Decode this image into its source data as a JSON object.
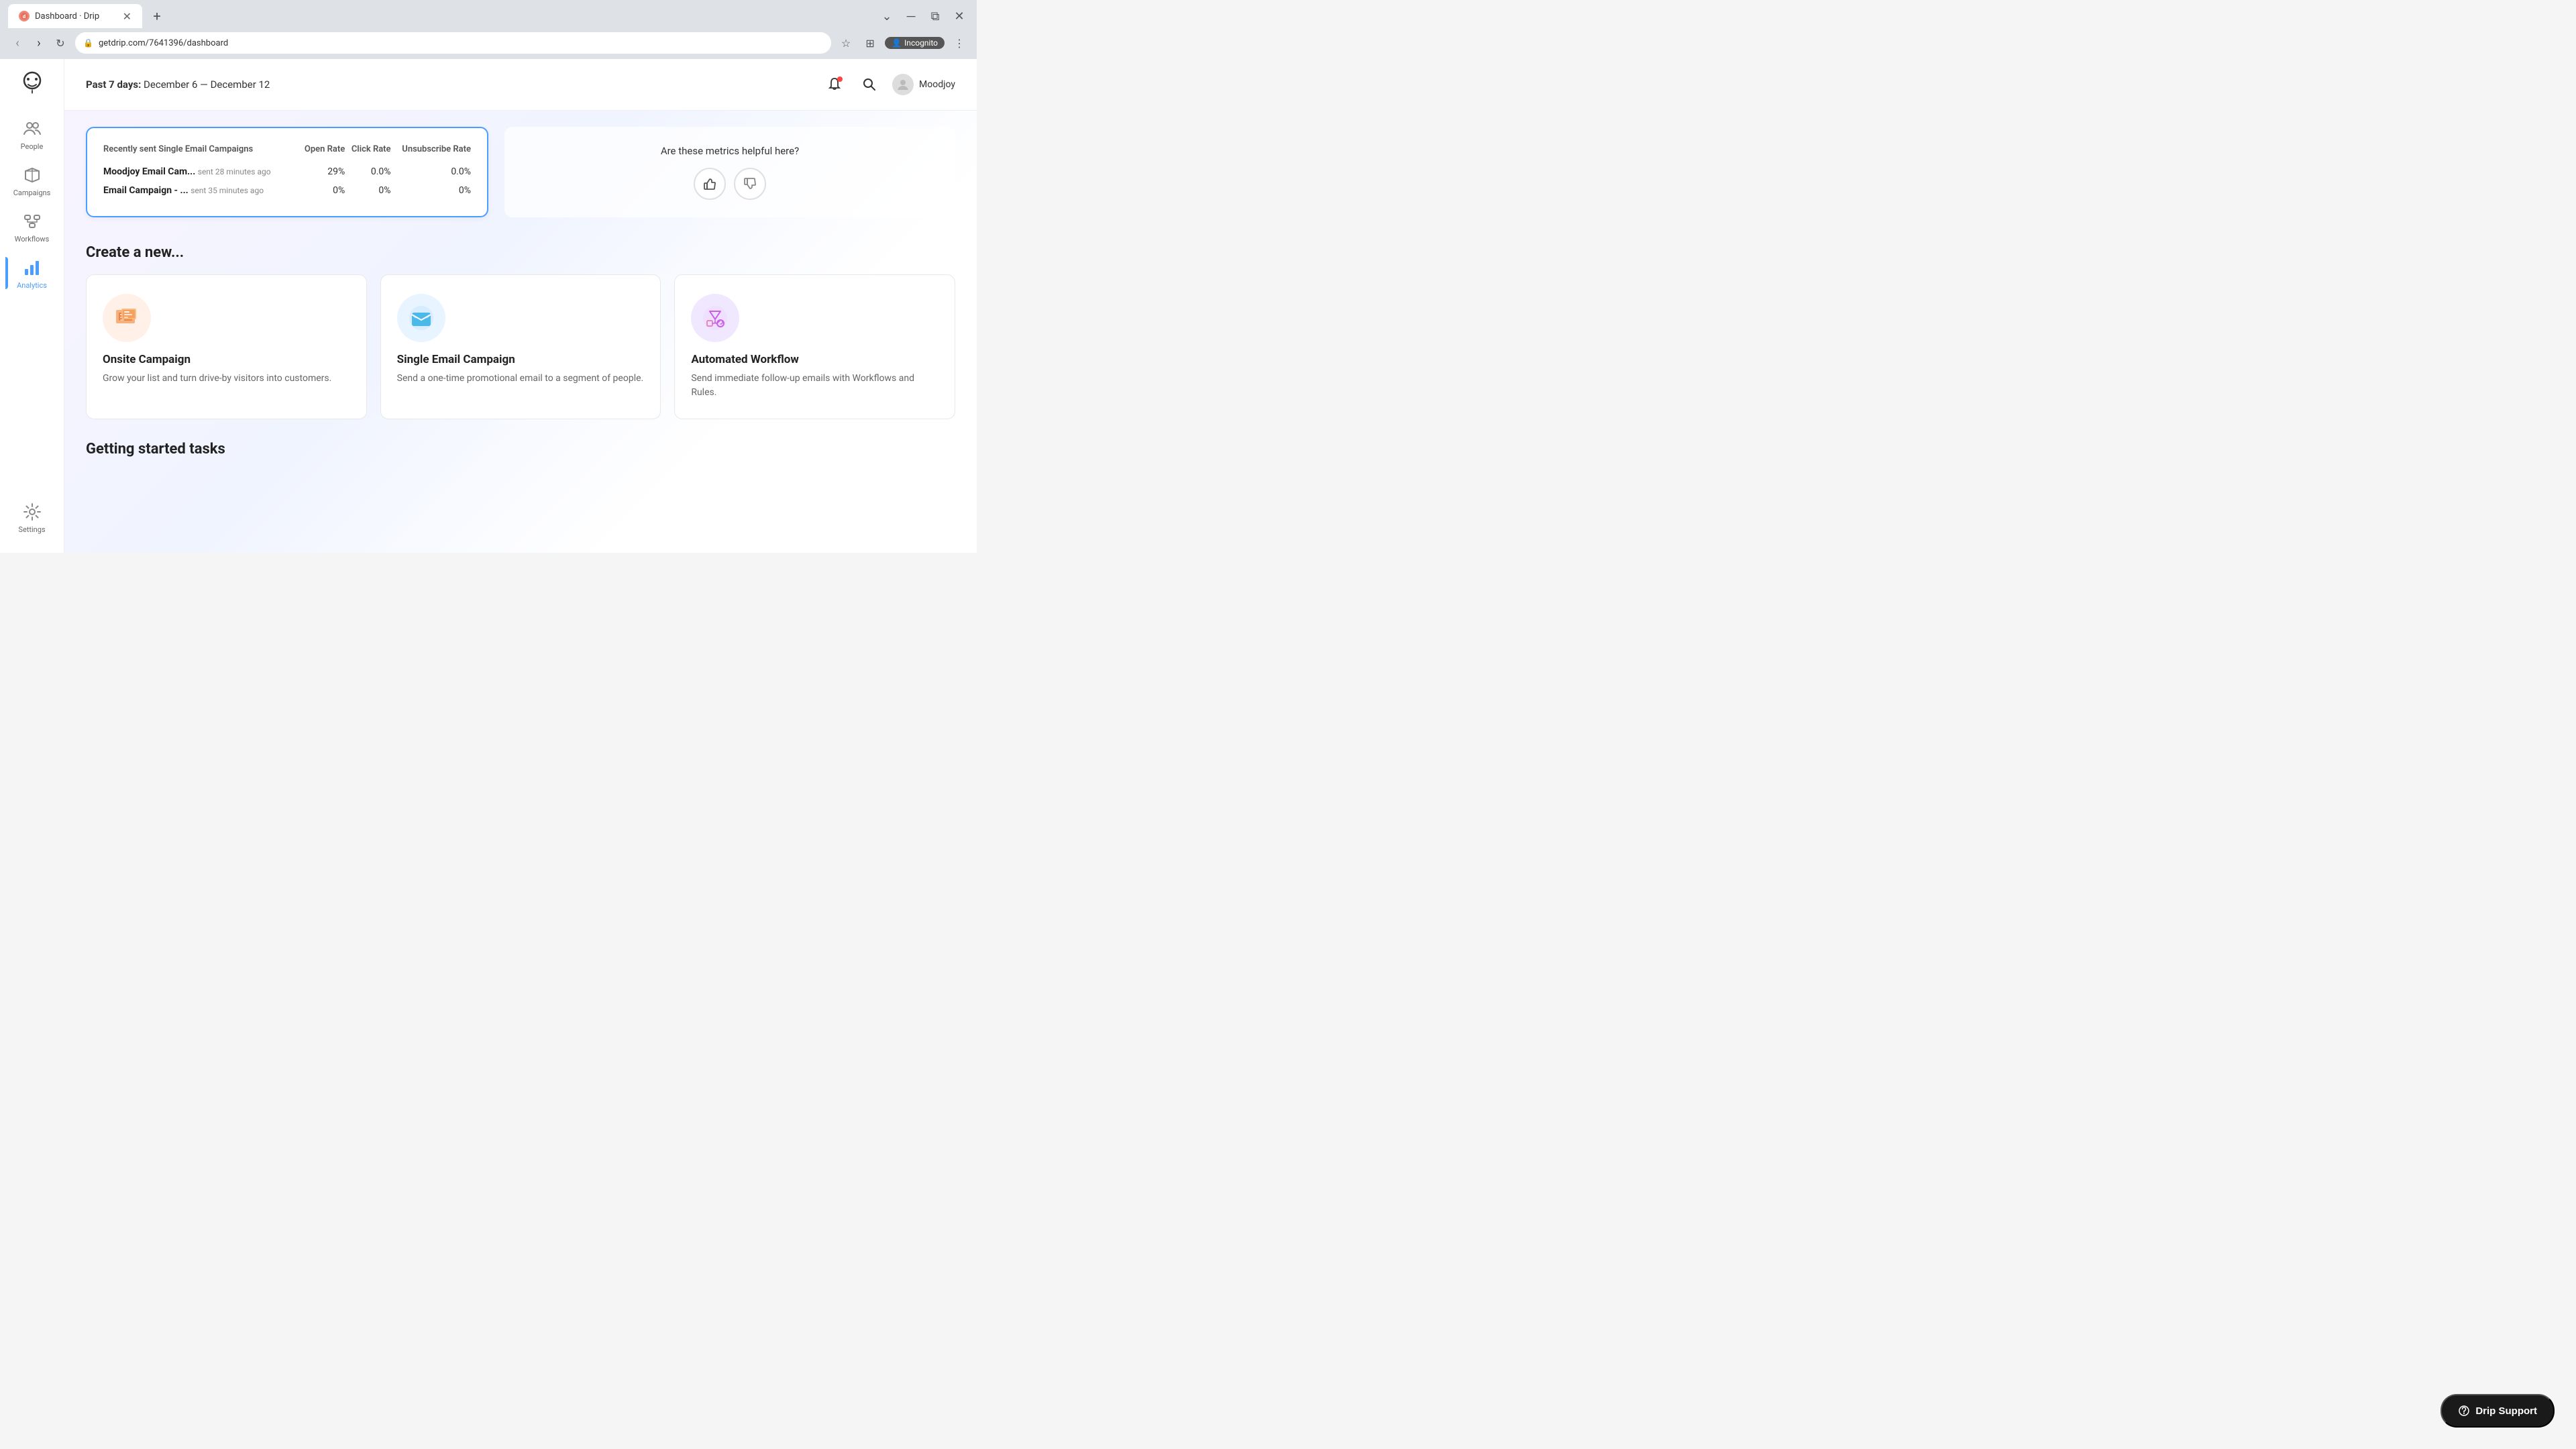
{
  "browser": {
    "tab_title": "Dashboard · Drip",
    "url": "getdrip.com/7641396/dashboard",
    "user": "Incognito"
  },
  "header": {
    "date_prefix": "Past 7 days:",
    "date_range": "December 6 — December 12"
  },
  "user": {
    "name": "Moodjoy"
  },
  "sidebar": {
    "items": [
      {
        "id": "people",
        "label": "People"
      },
      {
        "id": "campaigns",
        "label": "Campaigns"
      },
      {
        "id": "workflows",
        "label": "Workflows"
      },
      {
        "id": "analytics",
        "label": "Analytics"
      }
    ],
    "settings_label": "Settings"
  },
  "campaigns_table": {
    "title": "Recently sent Single Email Campaigns",
    "columns": [
      "Open Rate",
      "Click Rate",
      "Unsubscribe Rate"
    ],
    "rows": [
      {
        "name": "Moodjoy Email Cam...",
        "time": "sent 28 minutes ago",
        "open_rate": "29%",
        "click_rate": "0.0%",
        "unsubscribe_rate": "0.0%"
      },
      {
        "name": "Email Campaign - ...",
        "time": "sent 35 minutes ago",
        "open_rate": "0%",
        "click_rate": "0%",
        "unsubscribe_rate": "0%"
      }
    ]
  },
  "feedback": {
    "question": "Are these metrics helpful here?"
  },
  "create_section": {
    "title": "Create a new...",
    "cards": [
      {
        "id": "onsite",
        "name": "Onsite Campaign",
        "desc": "Grow your list and turn drive-by visitors into customers.",
        "icon": "📋",
        "icon_style": "orange"
      },
      {
        "id": "single_email",
        "name": "Single Email Campaign",
        "desc": "Send a one-time promotional email to a segment of people.",
        "icon": "✉️",
        "icon_style": "blue"
      },
      {
        "id": "workflow",
        "name": "Automated Workflow",
        "desc": "Send immediate follow-up emails with Workflows and Rules.",
        "icon": "⚙️",
        "icon_style": "purple"
      }
    ]
  },
  "getting_started": {
    "title": "Getting started tasks"
  },
  "drip_support": {
    "label": "Drip Support"
  }
}
